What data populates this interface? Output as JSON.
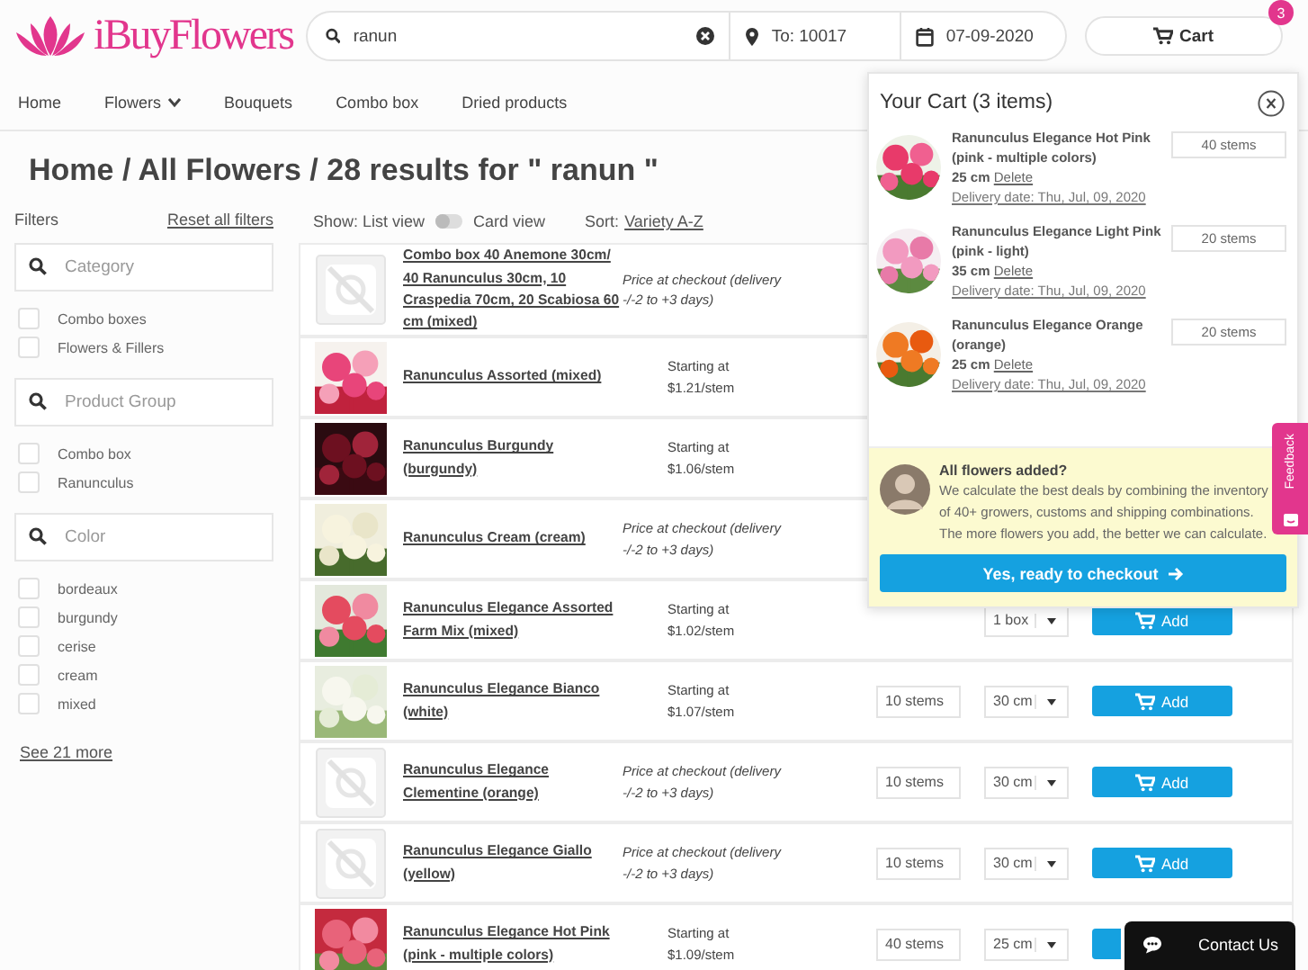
{
  "header": {
    "logo": "iBuyFlowers",
    "search": {
      "value": "ranun"
    },
    "zip": {
      "value": "To: 10017"
    },
    "date": {
      "value": "07-09-2020"
    },
    "cart": {
      "label": "Cart",
      "badge": "3"
    }
  },
  "nav": [
    {
      "label": "Home",
      "dropdown": false
    },
    {
      "label": "Flowers",
      "dropdown": true
    },
    {
      "label": "Bouquets",
      "dropdown": false
    },
    {
      "label": "Combo box",
      "dropdown": false
    },
    {
      "label": "Dried products",
      "dropdown": false
    }
  ],
  "heading": "Home / All Flowers / 28 results for \" ranun \"",
  "filters": {
    "title": "Filters",
    "reset": "Reset all filters",
    "groups": [
      {
        "placeholder": "Category",
        "options": [
          {
            "label": "Combo boxes",
            "checked": false
          },
          {
            "label": "Flowers & Fillers",
            "checked": false
          }
        ]
      },
      {
        "placeholder": "Product Group",
        "options": [
          {
            "label": "Combo box",
            "checked": false
          },
          {
            "label": "Ranunculus",
            "checked": false
          }
        ]
      },
      {
        "placeholder": "Color",
        "options": [
          {
            "label": "bordeaux",
            "checked": false
          },
          {
            "label": "burgundy",
            "checked": false
          },
          {
            "label": "cerise",
            "checked": false
          },
          {
            "label": "cream",
            "checked": false
          },
          {
            "label": "mixed",
            "checked": false
          }
        ]
      }
    ],
    "more": "See 21 more"
  },
  "toolbar": {
    "show_label": "Show: List view",
    "card_view": false,
    "card_label": "Card view",
    "sort_label": "Sort:",
    "sort_value": "Variety A-Z"
  },
  "products": [
    {
      "name": "Combo box 40 Anemone 30cm/ 40 Ranunculus 30cm, 10 Craspedia 70cm, 20 Scabiosa 60 cm (mixed)",
      "image": {
        "kind": "placeholder"
      },
      "price": "Price at checkout (delivery -/-2 to +3 days)"
    },
    {
      "name": "Ranunculus Assorted (mixed)",
      "price_label": "Starting at",
      "price": "$1.21/stem"
    },
    {
      "name": "Ranunculus Burgundy (burgundy)",
      "price_label": "Starting at",
      "price": "$1.06/stem"
    },
    {
      "name": "Ranunculus Cream (cream)",
      "price": "Price at checkout (delivery -/-2 to +3 days)"
    },
    {
      "name": "Ranunculus Elegance Assorted Farm Mix (mixed)",
      "price_label": "Starting at",
      "price": "$1.02/stem",
      "length": "1 box",
      "add": "Add"
    },
    {
      "name": "Ranunculus Elegance Bianco (white)",
      "price_label": "Starting at",
      "price": "$1.07/stem",
      "quantity": "10 stems",
      "length": "30 cm",
      "add": "Add"
    },
    {
      "name": "Ranunculus Elegance Clementine (orange)",
      "image": {
        "kind": "placeholder"
      },
      "price": "Price at checkout (delivery -/-2 to +3 days)",
      "quantity": "10 stems",
      "length": "30 cm",
      "add": "Add"
    },
    {
      "name": "Ranunculus Elegance Giallo (yellow)",
      "image": {
        "kind": "placeholder"
      },
      "price": "Price at checkout (delivery -/-2 to +3 days)",
      "quantity": "10 stems",
      "length": "30 cm",
      "add": "Add"
    },
    {
      "name": "Ranunculus Elegance Hot Pink (pink - multiple colors)",
      "price_label": "Starting at",
      "price": "$1.09/stem",
      "quantity": "40 stems",
      "length": "25 cm",
      "add_partial": true
    }
  ],
  "cart": {
    "title": "Your Cart (3 items)",
    "items": [
      {
        "name": "Ranunculus Elegance Hot Pink (pink - multiple colors)",
        "length": "25 cm",
        "delete": "Delete",
        "delivery": "Delivery date: Thu, Jul, 09, 2020",
        "quantity": "40 stems"
      },
      {
        "name": "Ranunculus Elegance Light Pink (pink - light)",
        "length": "35 cm",
        "delete": "Delete",
        "delivery": "Delivery date: Thu, Jul, 09, 2020",
        "quantity": "20 stems"
      },
      {
        "name": "Ranunculus Elegance Orange (orange)",
        "length": "25 cm",
        "delete": "Delete",
        "delivery": "Delivery date: Thu, Jul, 09, 2020",
        "quantity": "20 stems"
      }
    ],
    "advice": {
      "title": "All flowers added?",
      "text": "We calculate the best deals by combining the inventory of 40+ growers, customs and shipping combinations. The more flowers you add, the better we can calculate.",
      "button": "Yes, ready to checkout"
    }
  },
  "feedback": "Feedback",
  "contact": "Contact Us"
}
